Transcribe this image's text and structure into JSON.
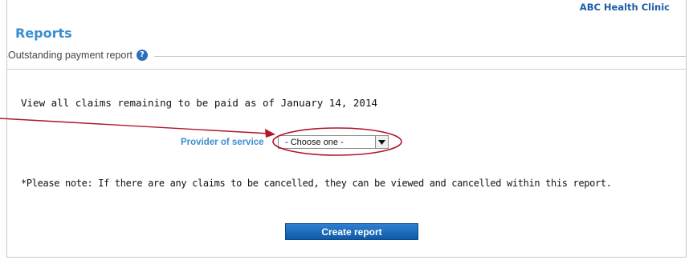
{
  "header": {
    "clinic_name": "ABC Health Clinic",
    "page_title": "Reports"
  },
  "section": {
    "heading": "Outstanding payment report",
    "help_icon_glyph": "?",
    "help_icon": "help-icon"
  },
  "report": {
    "intro_text": "View all claims remaining to be paid as of January 14, 2014",
    "provider_label": "Provider of service",
    "provider_select": {
      "selected": "- Choose one -",
      "icon": "dropdown-arrow-icon"
    },
    "note_text": "*Please note: If there are any claims to be cancelled, they can be viewed and cancelled within this report.",
    "create_button_label": "Create report"
  },
  "colors": {
    "accent_blue": "#3a8ed1",
    "button_blue": "#1a66b8",
    "annotation_red": "#b0152a",
    "border_gray": "#c8c8c8"
  }
}
